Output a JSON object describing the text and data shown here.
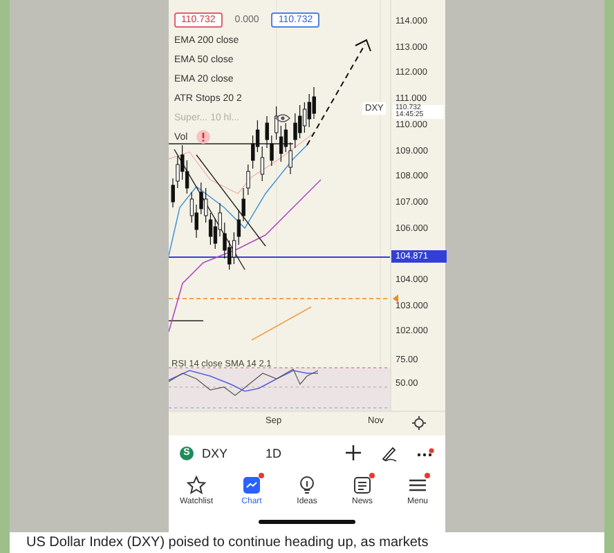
{
  "legend": {
    "prices": [
      {
        "text": "110.732",
        "kind": "bid"
      },
      {
        "text": "0.000",
        "kind": "spread"
      },
      {
        "text": "110.732",
        "kind": "ask"
      }
    ],
    "indicators": [
      {
        "label": "EMA 200 close",
        "hidden": false,
        "warning": false
      },
      {
        "label": "EMA 50 close",
        "hidden": false,
        "warning": false
      },
      {
        "label": "EMA 20 close",
        "hidden": false,
        "warning": false
      },
      {
        "label": "ATR Stops 20 2",
        "hidden": false,
        "warning": false
      },
      {
        "label": "Super... 10 hl...",
        "hidden": true,
        "warning": false
      },
      {
        "label": "Vol",
        "hidden": false,
        "warning": true
      }
    ]
  },
  "price_scale": {
    "ticks": [
      "114.000",
      "113.000",
      "112.000",
      "111.000",
      "110.000",
      "109.000",
      "108.000",
      "107.000",
      "106.000",
      "104.000",
      "103.000",
      "102.000"
    ],
    "symbol_tag": "DXY",
    "last_price": "110.732",
    "countdown": "14:45:25",
    "line_price": "104.871"
  },
  "rsi": {
    "label": "RSI 14 close SMA 14 2.1",
    "ticks": [
      "75.00",
      "50.00"
    ]
  },
  "time_axis": [
    "Sep",
    "Nov"
  ],
  "toolbar": {
    "symbol": "DXY",
    "symbol_badge": "S",
    "interval": "1D"
  },
  "nav": [
    {
      "label": "Watchlist",
      "kind": "star",
      "selected": false,
      "dot": false
    },
    {
      "label": "Chart",
      "kind": "chart",
      "selected": true,
      "dot": true
    },
    {
      "label": "Ideas",
      "kind": "bulb",
      "selected": false,
      "dot": false
    },
    {
      "label": "News",
      "kind": "news",
      "selected": false,
      "dot": true
    },
    {
      "label": "Menu",
      "kind": "menu",
      "selected": false,
      "dot": true
    }
  ],
  "caption": "US Dollar Index (DXY) poised to continue heading up, as markets"
}
